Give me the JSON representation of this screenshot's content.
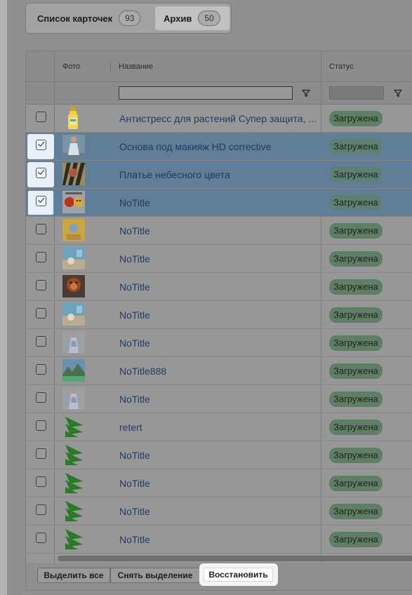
{
  "tabs": {
    "cards": {
      "label": "Список карточек",
      "count": "93"
    },
    "archive": {
      "label": "Архив",
      "count": "50"
    }
  },
  "table": {
    "columns": {
      "photo": "Фото",
      "name": "Название",
      "status": "Статус"
    },
    "filter": {
      "name_value": "",
      "status_value": ""
    },
    "rows": [
      {
        "name": "Антистресс для растений Супер защита, ...",
        "status": "Загружена",
        "selected": false,
        "thumb": "bottle-image"
      },
      {
        "name": "Основа под макияж HD corrective",
        "status": "Загружена",
        "selected": true,
        "thumb": "photo-person"
      },
      {
        "name": "Платье небесного цвета",
        "status": "Загружена",
        "selected": true,
        "thumb": "photo-zebra"
      },
      {
        "name": "NoTitle",
        "status": "Загружена",
        "selected": true,
        "thumb": "photo-emoji"
      },
      {
        "name": "NoTitle",
        "status": "Загружена",
        "selected": false,
        "thumb": "photo-yellow"
      },
      {
        "name": "NoTitle",
        "status": "Загружена",
        "selected": false,
        "thumb": "photo-sea"
      },
      {
        "name": "NoTitle",
        "status": "Загружена",
        "selected": false,
        "thumb": "photo-orangutan"
      },
      {
        "name": "NoTitle",
        "status": "Загружена",
        "selected": false,
        "thumb": "photo-sea"
      },
      {
        "name": "NoTitle",
        "status": "Загружена",
        "selected": false,
        "thumb": "photo-dress"
      },
      {
        "name": "NoTitle888",
        "status": "Загружена",
        "selected": false,
        "thumb": "photo-landscape"
      },
      {
        "name": "NoTitle",
        "status": "Загружена",
        "selected": false,
        "thumb": "photo-dress"
      },
      {
        "name": "retert",
        "status": "Загружена",
        "selected": false,
        "thumb": "green-logo"
      },
      {
        "name": "NoTitle",
        "status": "Загружена",
        "selected": false,
        "thumb": "green-logo"
      },
      {
        "name": "NoTitle",
        "status": "Загружена",
        "selected": false,
        "thumb": "green-logo"
      },
      {
        "name": "NoTitle",
        "status": "Загружена",
        "selected": false,
        "thumb": "green-logo"
      },
      {
        "name": "NoTitle",
        "status": "Загружена",
        "selected": false,
        "thumb": "green-logo"
      }
    ]
  },
  "footer": {
    "select_all": "Выделить все",
    "deselect": "Снять выделение",
    "restore": "Восстановить"
  }
}
